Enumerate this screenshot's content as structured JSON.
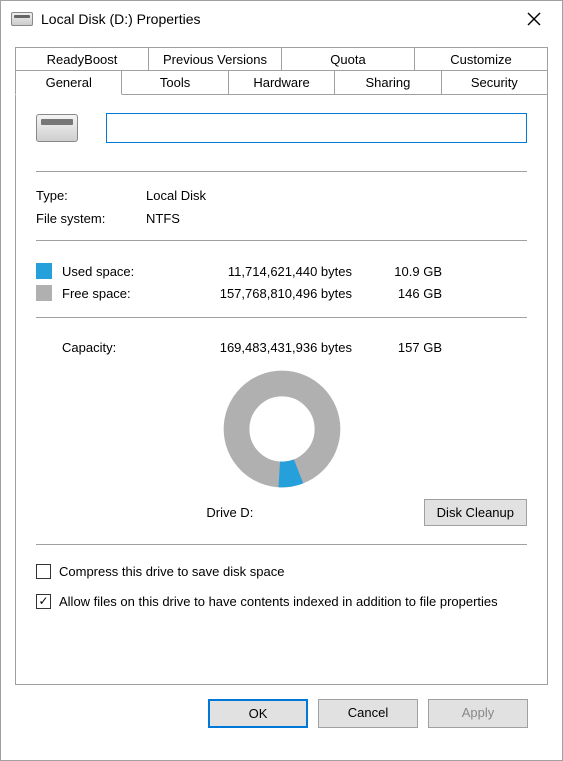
{
  "window": {
    "title": "Local Disk (D:) Properties"
  },
  "tabs": {
    "back": [
      "ReadyBoost",
      "Previous Versions",
      "Quota",
      "Customize"
    ],
    "front": [
      "General",
      "Tools",
      "Hardware",
      "Sharing",
      "Security"
    ],
    "active": "General"
  },
  "general": {
    "name_value": "",
    "type_label": "Type:",
    "type_value": "Local Disk",
    "fs_label": "File system:",
    "fs_value": "NTFS",
    "used_label": "Used space:",
    "used_bytes": "11,714,621,440 bytes",
    "used_readable": "10.9 GB",
    "free_label": "Free space:",
    "free_bytes": "157,768,810,496 bytes",
    "free_readable": "146 GB",
    "capacity_label": "Capacity:",
    "capacity_bytes": "169,483,431,936 bytes",
    "capacity_readable": "157 GB",
    "drive_label": "Drive D:",
    "cleanup_button": "Disk Cleanup",
    "compress_label": "Compress this drive to save disk space",
    "index_label": "Allow files on this drive to have contents indexed in addition to file properties",
    "compress_checked": false,
    "index_checked": true,
    "colors": {
      "used": "#26a0da",
      "free": "#b0b0b0"
    }
  },
  "chart_data": {
    "type": "pie",
    "title": "Drive D:",
    "series": [
      {
        "name": "Used space",
        "value": 11714621440,
        "readable": "10.9 GB",
        "color": "#26a0da"
      },
      {
        "name": "Free space",
        "value": 157768810496,
        "readable": "146 GB",
        "color": "#b0b0b0"
      }
    ],
    "total": 169483431936,
    "total_readable": "157 GB"
  },
  "footer": {
    "ok": "OK",
    "cancel": "Cancel",
    "apply": "Apply"
  }
}
